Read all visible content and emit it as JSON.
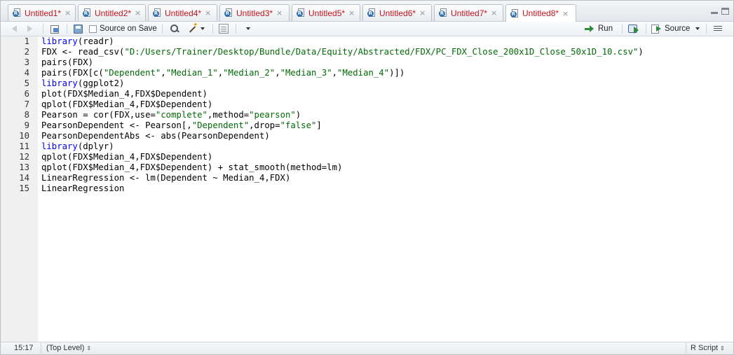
{
  "tabs": [
    {
      "label": "Untitled1*",
      "active": false
    },
    {
      "label": "Untitled2*",
      "active": false
    },
    {
      "label": "Untitled4*",
      "active": false
    },
    {
      "label": "Untitled3*",
      "active": false
    },
    {
      "label": "Untitled5*",
      "active": false
    },
    {
      "label": "Untitled6*",
      "active": false
    },
    {
      "label": "Untitled7*",
      "active": false
    },
    {
      "label": "Untitled8*",
      "active": true
    }
  ],
  "tab_close_glyph": "×",
  "toolbar": {
    "source_on_save_label": "Source on Save",
    "source_on_save_checked": false,
    "run_label": "Run",
    "source_label": "Source"
  },
  "editor": {
    "lines": [
      {
        "n": "1",
        "tokens": [
          {
            "t": "library",
            "c": "kw"
          },
          {
            "t": "(readr)",
            "c": ""
          }
        ]
      },
      {
        "n": "2",
        "tokens": [
          {
            "t": "FDX <- read_csv(",
            "c": ""
          },
          {
            "t": "\"D:/Users/Trainer/Desktop/Bundle/Data/Equity/Abstracted/FDX/PC_FDX_Close_200x1D_Close_50x1D_10.csv\"",
            "c": "str"
          },
          {
            "t": ")",
            "c": ""
          }
        ]
      },
      {
        "n": "3",
        "tokens": [
          {
            "t": "pairs(FDX)",
            "c": ""
          }
        ]
      },
      {
        "n": "4",
        "tokens": [
          {
            "t": "pairs(FDX[c(",
            "c": ""
          },
          {
            "t": "\"Dependent\"",
            "c": "str"
          },
          {
            "t": ",",
            "c": ""
          },
          {
            "t": "\"Median_1\"",
            "c": "str"
          },
          {
            "t": ",",
            "c": ""
          },
          {
            "t": "\"Median_2\"",
            "c": "str"
          },
          {
            "t": ",",
            "c": ""
          },
          {
            "t": "\"Median_3\"",
            "c": "str"
          },
          {
            "t": ",",
            "c": ""
          },
          {
            "t": "\"Median_4\"",
            "c": "str"
          },
          {
            "t": ")])",
            "c": ""
          }
        ]
      },
      {
        "n": "5",
        "tokens": [
          {
            "t": "library",
            "c": "kw"
          },
          {
            "t": "(ggplot2)",
            "c": ""
          }
        ]
      },
      {
        "n": "6",
        "tokens": [
          {
            "t": "plot(FDX$Median_4,FDX$Dependent)",
            "c": ""
          }
        ]
      },
      {
        "n": "7",
        "tokens": [
          {
            "t": "qplot(FDX$Median_4,FDX$Dependent)",
            "c": ""
          }
        ]
      },
      {
        "n": "8",
        "tokens": [
          {
            "t": "Pearson = cor(FDX,use=",
            "c": ""
          },
          {
            "t": "\"complete\"",
            "c": "str"
          },
          {
            "t": ",method=",
            "c": ""
          },
          {
            "t": "\"pearson\"",
            "c": "str"
          },
          {
            "t": ")",
            "c": ""
          }
        ]
      },
      {
        "n": "9",
        "tokens": [
          {
            "t": "PearsonDependent <- Pearson[,",
            "c": ""
          },
          {
            "t": "\"Dependent\"",
            "c": "str"
          },
          {
            "t": ",drop=",
            "c": ""
          },
          {
            "t": "\"false\"",
            "c": "str"
          },
          {
            "t": "]",
            "c": ""
          }
        ]
      },
      {
        "n": "10",
        "tokens": [
          {
            "t": "PearsonDependentAbs <- abs(PearsonDependent)",
            "c": ""
          }
        ]
      },
      {
        "n": "11",
        "tokens": [
          {
            "t": "library",
            "c": "kw"
          },
          {
            "t": "(dplyr)",
            "c": ""
          }
        ]
      },
      {
        "n": "12",
        "tokens": [
          {
            "t": "qplot(FDX$Median_4,FDX$Dependent)",
            "c": ""
          }
        ]
      },
      {
        "n": "13",
        "tokens": [
          {
            "t": "qplot(FDX$Median_4,FDX$Dependent) + stat_smooth(method=lm)",
            "c": ""
          }
        ]
      },
      {
        "n": "14",
        "tokens": [
          {
            "t": "LinearRegression <- lm(Dependent ~ Median_4,FDX)",
            "c": ""
          }
        ]
      },
      {
        "n": "15",
        "tokens": [
          {
            "t": "LinearRegression",
            "c": ""
          }
        ]
      }
    ]
  },
  "status": {
    "cursor_position": "15:17",
    "scope": "(Top Level)",
    "file_type": "R Script"
  },
  "colors": {
    "tab_label": "#c0161e",
    "keyword": "#0000ff",
    "string": "#036a07",
    "gutter": "#f0f0f0"
  }
}
